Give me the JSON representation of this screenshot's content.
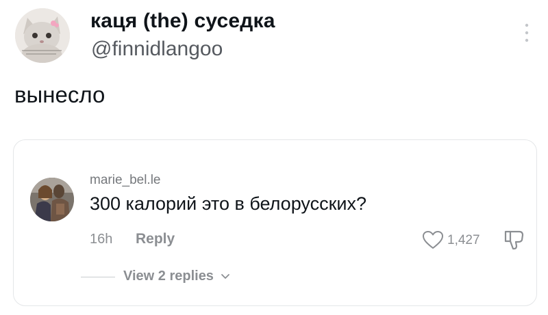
{
  "tweet": {
    "author_name": "каця (the) суседка",
    "author_handle": "@finnidlangoo",
    "text": "вынесло",
    "avatar_icon": "kitten-avatar"
  },
  "quoted_comment": {
    "username": "marie_bel.le",
    "text": "300 калорий это в белорусских?",
    "time": "16h",
    "reply_label": "Reply",
    "like_count": "1,427",
    "view_replies_label": "View 2 replies",
    "icons": [
      "heart-icon",
      "dislike-icon",
      "chevron-down-icon",
      "more-options-icon"
    ]
  },
  "colors": {
    "text_primary": "#0f1419",
    "text_secondary": "#55595f",
    "meta_gray": "#8b8e92",
    "card_border": "#e4e6e8"
  }
}
